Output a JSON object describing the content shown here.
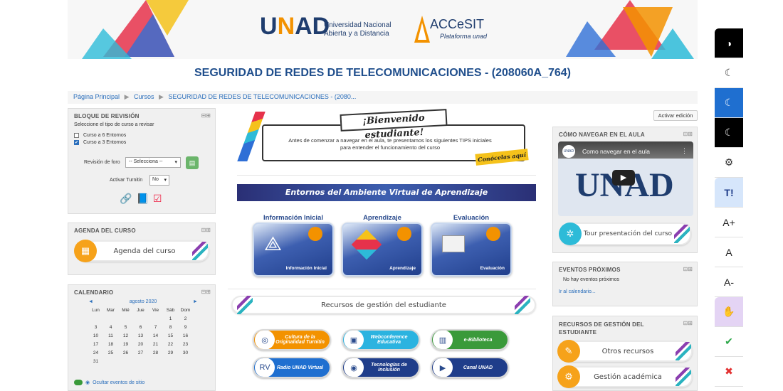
{
  "header": {
    "logo_unad": "UNAD",
    "logo_unad_line1": "Universidad Nacional",
    "logo_unad_line2": "Abierta y a Distancia",
    "logo_accesit": "ACCeSIT",
    "logo_accesit_sub": "Plataforma unad"
  },
  "page_title": "SEGURIDAD DE REDES DE TELECOMUNICACIONES - (208060A_764)",
  "breadcrumb": [
    "Página Principal",
    "Cursos",
    "SEGURIDAD DE REDES DE TELECOMUNICACIONES - (2080..."
  ],
  "edit_button": "Activar edición",
  "revision": {
    "title": "BLOQUE DE REVISIÓN",
    "instruction": "Seleccione el tipo de curso a revisar",
    "option1": "Curso a 6 Entornos",
    "option2": "Curso a 3 Entornos",
    "forum_label": "Revisión de foro",
    "forum_select": "-- Selecciona --",
    "turnitin_label": "Activar Turnitin",
    "turnitin_select": "No"
  },
  "agenda": {
    "title": "AGENDA DEL CURSO",
    "button": "Agenda del curso"
  },
  "calendar": {
    "title": "CALENDARIO",
    "month": "agosto 2020",
    "prev": "◄",
    "next": "►",
    "days": [
      "Lun",
      "Mar",
      "Mié",
      "Jue",
      "Vie",
      "Sáb",
      "Dom"
    ],
    "weeks": [
      [
        "",
        "",
        "",
        "",
        "",
        "1",
        "2"
      ],
      [
        "3",
        "4",
        "5",
        "6",
        "7",
        "8",
        "9"
      ],
      [
        "10",
        "11",
        "12",
        "13",
        "14",
        "15",
        "16"
      ],
      [
        "17",
        "18",
        "19",
        "20",
        "21",
        "22",
        "23"
      ],
      [
        "24",
        "25",
        "26",
        "27",
        "28",
        "29",
        "30"
      ],
      [
        "31",
        "",
        "",
        "",
        "",
        "",
        ""
      ]
    ],
    "hide_site_events": "Ocultar eventos de sitio"
  },
  "welcome": {
    "heading": "¡Bienvenido estudiante!",
    "text": "Antes de comenzar a navegar en el aula, te presentamos los siguientes TIPS iniciales para entender el funcionamiento del curso",
    "cta": "Conócelas aquí"
  },
  "environments_banner": "Entornos del Ambiente Virtual de Aprendizaje",
  "sections": [
    {
      "title": "Información Inicial",
      "caption": "Información Inicial"
    },
    {
      "title": "Aprendizaje",
      "caption": "Aprendizaje"
    },
    {
      "title": "Evaluación",
      "caption": "Evaluación"
    }
  ],
  "resources_banner": "Recursos de gestión del estudiante",
  "resources": [
    {
      "label": "Cultura de la Originalidad Turnitin",
      "color": "#f39200"
    },
    {
      "label": "Webconference Educativa",
      "color": "#2bb3e0"
    },
    {
      "label": "e-Biblioteca",
      "color": "#3a9a3a"
    },
    {
      "label": "Radio UNAD Virtual",
      "color": "#1f6fd0"
    },
    {
      "label": "Tecnologías de inclusión",
      "color": "#1f3d8a"
    },
    {
      "label": "Canal UNAD",
      "color": "#1f3d8a"
    }
  ],
  "navigate": {
    "title": "CÓMO NAVEGAR EN EL AULA",
    "video_title": "Como navegar en el aula",
    "video_logo": "UNAD",
    "tour_button": "Tour presentación del curso"
  },
  "events": {
    "title": "EVENTOS PRÓXIMOS",
    "empty": "No hay eventos próximos",
    "link": "Ir al calendario..."
  },
  "mgmt": {
    "title": "RECURSOS DE GESTIÓN DEL ESTUDIANTE",
    "button1": "Otros recursos",
    "button2": "Gestión académica"
  },
  "accessibility_tools": [
    {
      "icon": "contrast-icon",
      "glyph": "◑",
      "label": ""
    },
    {
      "icon": "moon-icon",
      "glyph": "☾",
      "label": ""
    },
    {
      "icon": "moon-icon",
      "glyph": "☾",
      "label": ""
    },
    {
      "icon": "moon-icon",
      "glyph": "☾",
      "label": ""
    },
    {
      "icon": "gear-icon",
      "glyph": "⚙",
      "label": ""
    },
    {
      "icon": "text-icon",
      "glyph": "",
      "label": "T!"
    },
    {
      "icon": "font-increase-icon",
      "glyph": "",
      "label": "A+"
    },
    {
      "icon": "font-reset-icon",
      "glyph": "",
      "label": "A"
    },
    {
      "icon": "font-decrease-icon",
      "glyph": "",
      "label": "A-"
    },
    {
      "icon": "sign-language-icon",
      "glyph": "✋",
      "label": ""
    },
    {
      "icon": "check-icon",
      "glyph": "✔",
      "label": ""
    },
    {
      "icon": "close-icon",
      "glyph": "✖",
      "label": ""
    }
  ]
}
